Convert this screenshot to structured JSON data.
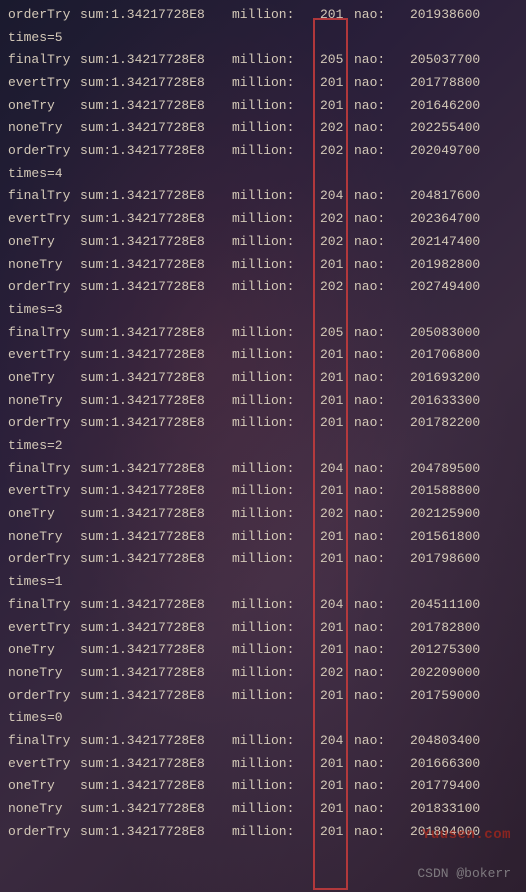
{
  "header_partial": {
    "label": "orderTry",
    "sum": "sum:1.34217728E8",
    "million": "million:",
    "mval": "201",
    "nao": "nao:",
    "nval": "201938600"
  },
  "blocks": [
    {
      "times": "times=5",
      "rows": [
        {
          "label": "finalTry",
          "sum": "sum:1.34217728E8",
          "million": "million:",
          "mval": "205",
          "nao": "nao:",
          "nval": "205037700"
        },
        {
          "label": "evertTry",
          "sum": "sum:1.34217728E8",
          "million": "million:",
          "mval": "201",
          "nao": "nao:",
          "nval": "201778800"
        },
        {
          "label": "oneTry",
          "sum": "sum:1.34217728E8",
          "million": "million:",
          "mval": "201",
          "nao": "nao:",
          "nval": "201646200"
        },
        {
          "label": "noneTry",
          "sum": "sum:1.34217728E8",
          "million": "million:",
          "mval": "202",
          "nao": "nao:",
          "nval": "202255400"
        },
        {
          "label": "orderTry",
          "sum": "sum:1.34217728E8",
          "million": "million:",
          "mval": "202",
          "nao": "nao:",
          "nval": "202049700"
        }
      ]
    },
    {
      "times": "times=4",
      "rows": [
        {
          "label": "finalTry",
          "sum": "sum:1.34217728E8",
          "million": "million:",
          "mval": "204",
          "nao": "nao:",
          "nval": "204817600"
        },
        {
          "label": "evertTry",
          "sum": "sum:1.34217728E8",
          "million": "million:",
          "mval": "202",
          "nao": "nao:",
          "nval": "202364700"
        },
        {
          "label": "oneTry",
          "sum": "sum:1.34217728E8",
          "million": "million:",
          "mval": "202",
          "nao": "nao:",
          "nval": "202147400"
        },
        {
          "label": "noneTry",
          "sum": "sum:1.34217728E8",
          "million": "million:",
          "mval": "201",
          "nao": "nao:",
          "nval": "201982800"
        },
        {
          "label": "orderTry",
          "sum": "sum:1.34217728E8",
          "million": "million:",
          "mval": "202",
          "nao": "nao:",
          "nval": "202749400"
        }
      ]
    },
    {
      "times": "times=3",
      "rows": [
        {
          "label": "finalTry",
          "sum": "sum:1.34217728E8",
          "million": "million:",
          "mval": "205",
          "nao": "nao:",
          "nval": "205083000"
        },
        {
          "label": "evertTry",
          "sum": "sum:1.34217728E8",
          "million": "million:",
          "mval": "201",
          "nao": "nao:",
          "nval": "201706800"
        },
        {
          "label": "oneTry",
          "sum": "sum:1.34217728E8",
          "million": "million:",
          "mval": "201",
          "nao": "nao:",
          "nval": "201693200"
        },
        {
          "label": "noneTry",
          "sum": "sum:1.34217728E8",
          "million": "million:",
          "mval": "201",
          "nao": "nao:",
          "nval": "201633300"
        },
        {
          "label": "orderTry",
          "sum": "sum:1.34217728E8",
          "million": "million:",
          "mval": "201",
          "nao": "nao:",
          "nval": "201782200"
        }
      ]
    },
    {
      "times": "times=2",
      "rows": [
        {
          "label": "finalTry",
          "sum": "sum:1.34217728E8",
          "million": "million:",
          "mval": "204",
          "nao": "nao:",
          "nval": "204789500"
        },
        {
          "label": "evertTry",
          "sum": "sum:1.34217728E8",
          "million": "million:",
          "mval": "201",
          "nao": "nao:",
          "nval": "201588800"
        },
        {
          "label": "oneTry",
          "sum": "sum:1.34217728E8",
          "million": "million:",
          "mval": "202",
          "nao": "nao:",
          "nval": "202125900"
        },
        {
          "label": "noneTry",
          "sum": "sum:1.34217728E8",
          "million": "million:",
          "mval": "201",
          "nao": "nao:",
          "nval": "201561800"
        },
        {
          "label": "orderTry",
          "sum": "sum:1.34217728E8",
          "million": "million:",
          "mval": "201",
          "nao": "nao:",
          "nval": "201798600"
        }
      ]
    },
    {
      "times": "times=1",
      "rows": [
        {
          "label": "finalTry",
          "sum": "sum:1.34217728E8",
          "million": "million:",
          "mval": "204",
          "nao": "nao:",
          "nval": "204511100"
        },
        {
          "label": "evertTry",
          "sum": "sum:1.34217728E8",
          "million": "million:",
          "mval": "201",
          "nao": "nao:",
          "nval": "201782800"
        },
        {
          "label": "oneTry",
          "sum": "sum:1.34217728E8",
          "million": "million:",
          "mval": "201",
          "nao": "nao:",
          "nval": "201275300"
        },
        {
          "label": "noneTry",
          "sum": "sum:1.34217728E8",
          "million": "million:",
          "mval": "202",
          "nao": "nao:",
          "nval": "202209000"
        },
        {
          "label": "orderTry",
          "sum": "sum:1.34217728E8",
          "million": "million:",
          "mval": "201",
          "nao": "nao:",
          "nval": "201759000"
        }
      ]
    },
    {
      "times": "times=0",
      "rows": [
        {
          "label": "finalTry",
          "sum": "sum:1.34217728E8",
          "million": "million:",
          "mval": "204",
          "nao": "nao:",
          "nval": "204803400"
        },
        {
          "label": "evertTry",
          "sum": "sum:1.34217728E8",
          "million": "million:",
          "mval": "201",
          "nao": "nao:",
          "nval": "201666300"
        },
        {
          "label": "oneTry",
          "sum": "sum:1.34217728E8",
          "million": "million:",
          "mval": "201",
          "nao": "nao:",
          "nval": "201779400"
        },
        {
          "label": "noneTry",
          "sum": "sum:1.34217728E8",
          "million": "million:",
          "mval": "201",
          "nao": "nao:",
          "nval": "201833100"
        },
        {
          "label": "orderTry",
          "sum": "sum:1.34217728E8",
          "million": "million:",
          "mval": "201",
          "nao": "nao:",
          "nval": "201894000"
        }
      ]
    }
  ],
  "watermarks": {
    "w1": "Yuusen.com",
    "w2": "CSDN @bokerr"
  }
}
